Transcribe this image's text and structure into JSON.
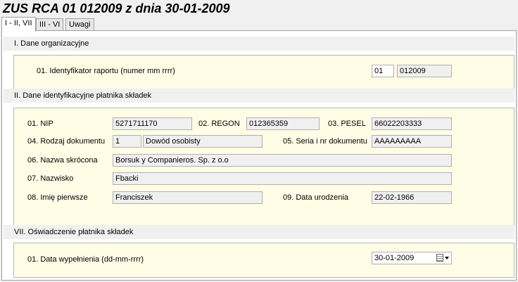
{
  "window": {
    "title": "ZUS RCA 01 012009 z dnia 30-01-2009"
  },
  "tabs": [
    {
      "label": "I - II, VII"
    },
    {
      "label": "III - VI"
    },
    {
      "label": "Uwagi"
    }
  ],
  "section1": {
    "header": "I. Dane organizacyjne",
    "report_id_label": "01. Identyfikator raportu (numer mm rrrr)",
    "report_number": "01",
    "report_period": "012009"
  },
  "section2": {
    "header": "II. Dane identyfikacyjne płatnika składek",
    "nip_label": "01. NIP",
    "nip": "5271711170",
    "regon_label": "02. REGON",
    "regon": "012365359",
    "pesel_label": "03. PESEL",
    "pesel": "66022203333",
    "doc_type_label": "04. Rodzaj dokumentu",
    "doc_type_code": "1",
    "doc_type_name": "Dowód osobisty",
    "doc_series_label": "05. Seria i nr dokumentu",
    "doc_series": "AAAAAAAAA",
    "short_name_label": "06. Nazwa skrócona",
    "short_name": "Borsuk y Companieros. Sp. z o.o",
    "surname_label": "07. Nazwisko",
    "surname": "Fbacki",
    "first_name_label": "08. Imię pierwsze",
    "first_name": "Franciszek",
    "birth_date_label": "09. Data urodzenia",
    "birth_date": "22-02-1966"
  },
  "section7": {
    "header": "VII. Oświadczenie płatnika składek",
    "fill_date_label": "01. Data wypełnienia (dd-mm-rrrr)",
    "fill_date": "30-01-2009"
  },
  "icons": {
    "calendar": "calendar-icon",
    "dropdown": "chevron-down-icon"
  }
}
